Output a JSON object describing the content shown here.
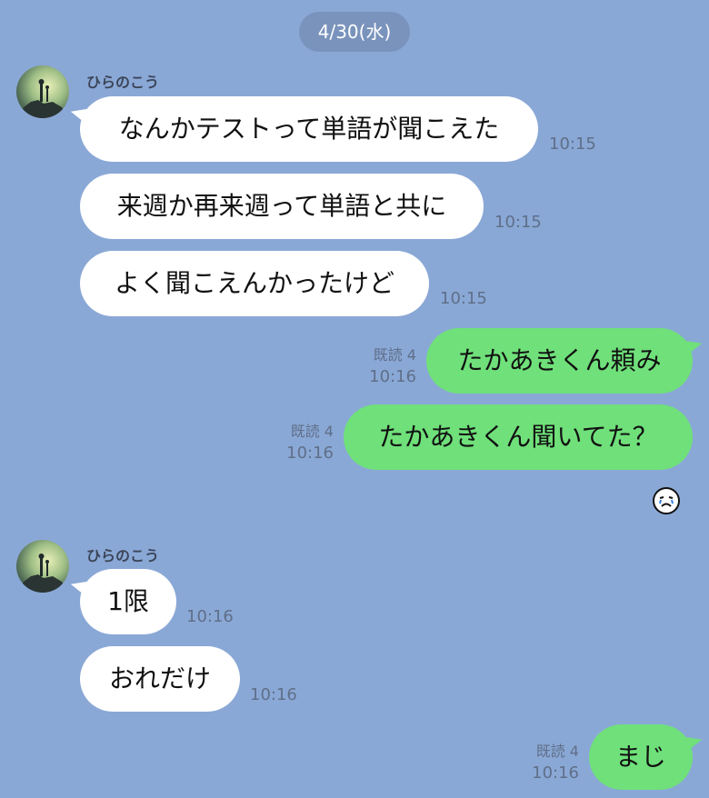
{
  "date_label": "4/30(水)",
  "sender_name": "ひらのこう",
  "messages_group1": [
    {
      "text": "なんかテストって単語が聞こえた",
      "time": "10:15"
    },
    {
      "text": "来週か再来週って単語と共に",
      "time": "10:15"
    },
    {
      "text": "よく聞こえんかったけど",
      "time": "10:15"
    }
  ],
  "my_messages1": [
    {
      "text": "たかあきくん頼み",
      "read": "既読 4",
      "time": "10:16"
    },
    {
      "text": "たかあきくん聞いてた？",
      "read": "既読 4",
      "time": "10:16"
    }
  ],
  "messages_group2": [
    {
      "text": "1限",
      "time": "10:16"
    },
    {
      "text": "おれだけ",
      "time": "10:16"
    }
  ],
  "my_messages2": [
    {
      "text": "まじ",
      "read": "既読 4",
      "time": "10:16"
    }
  ],
  "reaction_icon": "crying-face-icon"
}
